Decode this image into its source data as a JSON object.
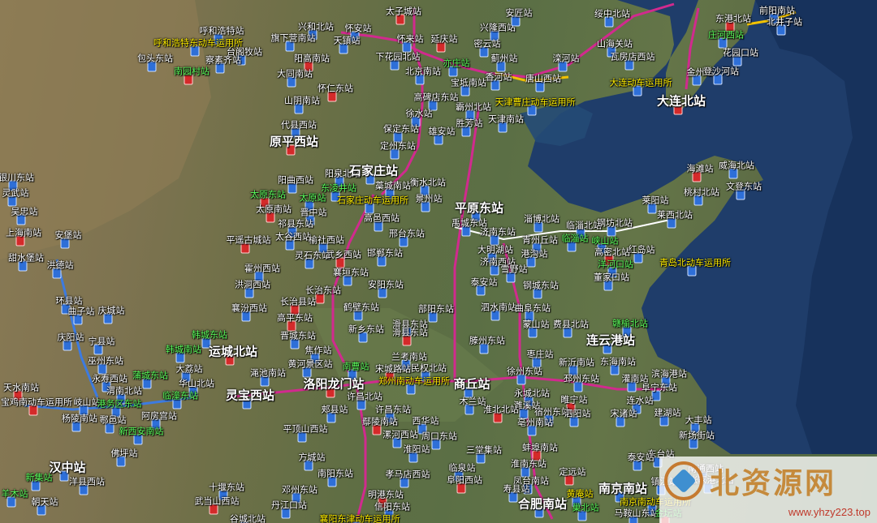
{
  "watermark": {
    "title": "北资源网",
    "url": "www.yhzy223.top"
  },
  "labels": [
    {
      "t": "太子城站"
    },
    {
      "t": "兴隆西站"
    },
    {
      "t": "安匠站"
    },
    {
      "t": "绥中北站"
    },
    {
      "t": "前阳南站"
    },
    {
      "t": "兴和北站"
    },
    {
      "t": "怀安站"
    },
    {
      "t": "东港北站"
    },
    {
      "t": "北井子站"
    },
    {
      "t": "呼和浩特站"
    },
    {
      "t": "呼和浩特东动车运用所"
    },
    {
      "t": "旗下营南站"
    },
    {
      "t": "天镇站"
    },
    {
      "t": "怀来站"
    },
    {
      "t": "延庆站"
    },
    {
      "t": "密云站"
    },
    {
      "t": "山海关站"
    },
    {
      "t": "庄河西站"
    },
    {
      "t": "台阁牧站"
    },
    {
      "t": "包头东站"
    },
    {
      "t": "察素齐站"
    },
    {
      "t": "阳高南站"
    },
    {
      "t": "下花园北站"
    },
    {
      "t": "亦庄站"
    },
    {
      "t": "蓟州站"
    },
    {
      "t": "滦河站"
    },
    {
      "t": "瓦房店西站"
    },
    {
      "t": "花园口站"
    },
    {
      "t": "南园村站"
    },
    {
      "t": "大同南站"
    },
    {
      "t": "北京南站"
    },
    {
      "t": "香河站"
    },
    {
      "t": "唐山西站"
    },
    {
      "t": "金州站"
    },
    {
      "t": "登沙河站"
    },
    {
      "t": "怀仁东站"
    },
    {
      "t": "宝坻南站"
    },
    {
      "t": "大连动车运用所"
    },
    {
      "t": "山阴南站"
    },
    {
      "t": "高碑店东站"
    },
    {
      "t": "霸州北站"
    },
    {
      "t": "天津曹庄动车运用所"
    },
    {
      "t": "大连北站"
    },
    {
      "t": "徐水站"
    },
    {
      "t": "天津南站"
    },
    {
      "t": "胜芳站"
    },
    {
      "t": "代县西站"
    },
    {
      "t": "保定东站"
    },
    {
      "t": "雄安站"
    },
    {
      "t": "原平西站"
    },
    {
      "t": "定州东站"
    },
    {
      "t": "银川东站"
    },
    {
      "t": "阳泉北站"
    },
    {
      "t": "石家庄站"
    },
    {
      "t": "藁城南站"
    },
    {
      "t": "衡水北站"
    },
    {
      "t": "海滩站"
    },
    {
      "t": "威海北站"
    },
    {
      "t": "阳曲西站"
    },
    {
      "t": "灵武站"
    },
    {
      "t": "东凌井站"
    },
    {
      "t": "桃村北站"
    },
    {
      "t": "文登东站"
    },
    {
      "t": "太原东站"
    },
    {
      "t": "太原站"
    },
    {
      "t": "石家庄动车运用所"
    },
    {
      "t": "景州站"
    },
    {
      "t": "平原东站"
    },
    {
      "t": "莱阳站"
    },
    {
      "t": "吴忠站"
    },
    {
      "t": "太原南站"
    },
    {
      "t": "晋中站"
    },
    {
      "t": "禹城东站"
    },
    {
      "t": "淄博北站"
    },
    {
      "t": "临淄北站"
    },
    {
      "t": "钢坊北站"
    },
    {
      "t": "莱西北站"
    },
    {
      "t": "上海南站"
    },
    {
      "t": "安堡站"
    },
    {
      "t": "祁县东站"
    },
    {
      "t": "高邑西站"
    },
    {
      "t": "济南东站"
    },
    {
      "t": "临淄站"
    },
    {
      "t": "峡山站"
    },
    {
      "t": "平遥古城站"
    },
    {
      "t": "太谷西站"
    },
    {
      "t": "榆社西站"
    },
    {
      "t": "邢台东站"
    },
    {
      "t": "青州丘站"
    },
    {
      "t": "甜水堡站"
    },
    {
      "t": "灵石东站"
    },
    {
      "t": "武乡西站"
    },
    {
      "t": "大明湖站"
    },
    {
      "t": "港沟站"
    },
    {
      "t": "红岛站"
    },
    {
      "t": "霍州西站"
    },
    {
      "t": "邯郸东站"
    },
    {
      "t": "济南西站"
    },
    {
      "t": "高密北站"
    },
    {
      "t": "洪德站"
    },
    {
      "t": "襄垣东站"
    },
    {
      "t": "雪野站"
    },
    {
      "t": "洋河口站"
    },
    {
      "t": "青岛北动车运用所"
    },
    {
      "t": "洪洞西站"
    },
    {
      "t": "长治东站"
    },
    {
      "t": "安阳东站"
    },
    {
      "t": "泰安站"
    },
    {
      "t": "钢城东站"
    },
    {
      "t": "董家口站"
    },
    {
      "t": "环县站"
    },
    {
      "t": "襄汾西站"
    },
    {
      "t": "长治县站"
    },
    {
      "t": "鹤壁东站"
    },
    {
      "t": "部阳东站"
    },
    {
      "t": "泗水南站"
    },
    {
      "t": "曲阜东站"
    },
    {
      "t": "曲子站"
    },
    {
      "t": "庆城站"
    },
    {
      "t": "高平东站"
    },
    {
      "t": "新乡东站"
    },
    {
      "t": "滑县东站"
    },
    {
      "t": "蒙山站"
    },
    {
      "t": "费县北站"
    },
    {
      "t": "赣榆北站"
    },
    {
      "t": "晋城东站"
    },
    {
      "t": "滑县东站"
    },
    {
      "t": "庆阳站"
    },
    {
      "t": "韩城东站"
    },
    {
      "t": "滕州东站"
    },
    {
      "t": "连云港站"
    },
    {
      "t": "宁县站"
    },
    {
      "t": "韩城南站"
    },
    {
      "t": "运城北站"
    },
    {
      "t": "焦作站"
    },
    {
      "t": "兰考南站"
    },
    {
      "t": "枣庄站"
    },
    {
      "t": "巫州东站"
    },
    {
      "t": "黄河景区站"
    },
    {
      "t": "南曹站"
    },
    {
      "t": "宋城路站"
    },
    {
      "t": "民权北站"
    },
    {
      "t": "新沂南站"
    },
    {
      "t": "东海南站"
    },
    {
      "t": "永寿西站"
    },
    {
      "t": "大荔站"
    },
    {
      "t": "渑池南站"
    },
    {
      "t": "洛阳龙门站"
    },
    {
      "t": "郑州南动车运用所"
    },
    {
      "t": "商丘站"
    },
    {
      "t": "徐州东站"
    },
    {
      "t": "邳州东站"
    },
    {
      "t": "灌南站"
    },
    {
      "t": "滨海港站"
    },
    {
      "t": "天水南站"
    },
    {
      "t": "蒲城东站"
    },
    {
      "t": "华山北站"
    },
    {
      "t": "渭南北站"
    },
    {
      "t": "许昌北站"
    },
    {
      "t": "永城北站"
    },
    {
      "t": "阜宁东站"
    },
    {
      "t": "宝鸡南动车运用所"
    },
    {
      "t": "岐山站"
    },
    {
      "t": "港务区东站"
    },
    {
      "t": "临潼东站"
    },
    {
      "t": "灵宝西站"
    },
    {
      "t": "木兰站"
    },
    {
      "t": "濉溪站"
    },
    {
      "t": "睢宁站"
    },
    {
      "t": "连水站"
    },
    {
      "t": "杨陵南站"
    },
    {
      "t": "鄠邑站"
    },
    {
      "t": "阿房宫站"
    },
    {
      "t": "郏县站"
    },
    {
      "t": "许昌东站"
    },
    {
      "t": "淮北北站"
    },
    {
      "t": "宿州东站"
    },
    {
      "t": "泗阳站"
    },
    {
      "t": "宋诸站"
    },
    {
      "t": "建湖站"
    },
    {
      "t": "大丰站"
    },
    {
      "t": "新西安南站"
    },
    {
      "t": "鄢陵南站"
    },
    {
      "t": "西华站"
    },
    {
      "t": "亳州南站"
    },
    {
      "t": "新场街站"
    },
    {
      "t": "平顶山西站"
    },
    {
      "t": "漯河西站"
    },
    {
      "t": "周口东站"
    },
    {
      "t": "蚌埠南站"
    },
    {
      "t": "东台站"
    },
    {
      "t": "三堂集站"
    },
    {
      "t": "佛坪站"
    },
    {
      "t": "方城站"
    },
    {
      "t": "淮阳站"
    },
    {
      "t": "淮南东站"
    },
    {
      "t": "定远站"
    },
    {
      "t": "泰安站"
    },
    {
      "t": "汉中站"
    },
    {
      "t": "洋县西站"
    },
    {
      "t": "南阳东站"
    },
    {
      "t": "孝马店西站"
    },
    {
      "t": "临泉站"
    },
    {
      "t": "阜阳西站"
    },
    {
      "t": "凤台南站"
    },
    {
      "t": "南通西站"
    },
    {
      "t": "张家港北站"
    },
    {
      "t": "新集站"
    },
    {
      "t": "十堰东站"
    },
    {
      "t": "邓州东站"
    },
    {
      "t": "明港东站"
    },
    {
      "t": "寿县站"
    },
    {
      "t": "黄庵站"
    },
    {
      "t": "南京南站"
    },
    {
      "t": "镇江站"
    },
    {
      "t": "羊木站"
    },
    {
      "t": "朝天站"
    },
    {
      "t": "武当山西站"
    },
    {
      "t": "丹江口站"
    },
    {
      "t": "信阳东站"
    },
    {
      "t": "合肥南站"
    },
    {
      "t": "巢北站"
    },
    {
      "t": "南京南动车运用所"
    },
    {
      "t": "马鞍山东站"
    },
    {
      "t": "金坛站"
    },
    {
      "t": "谷城北站"
    },
    {
      "t": "襄阳东津动车运用所"
    }
  ]
}
